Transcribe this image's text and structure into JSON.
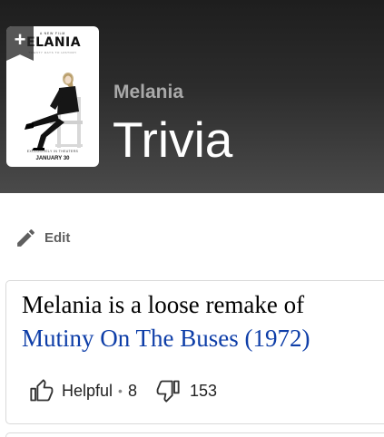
{
  "header": {
    "poster": {
      "kicker": "A NEW FILM",
      "title": "ELANIA",
      "subtitle": "TWENTY DAYS TO HISTORY",
      "release": "EXCLUSIVELY IN THEATERS",
      "date": "JANUARY 30",
      "watchlist_icon": "plus-icon"
    },
    "movie_name": "Melania",
    "page_title": "Trivia"
  },
  "actions": {
    "edit_label": "Edit",
    "edit_icon": "pencil-icon"
  },
  "trivia": {
    "text_prefix": "Melania is a loose remake of",
    "link_text": "Mutiny On The Buses (1972)",
    "helpful_label": "Helpful",
    "helpful_count": "8",
    "unhelpful_count": "153",
    "helpful_icon": "thumbs-up-icon",
    "unhelpful_icon": "thumbs-down-icon"
  },
  "colors": {
    "link": "#0e3ea8",
    "hero_background": "#2c2c2c",
    "title_text": "#ffffff",
    "movie_name_text": "#a9a9a9"
  }
}
